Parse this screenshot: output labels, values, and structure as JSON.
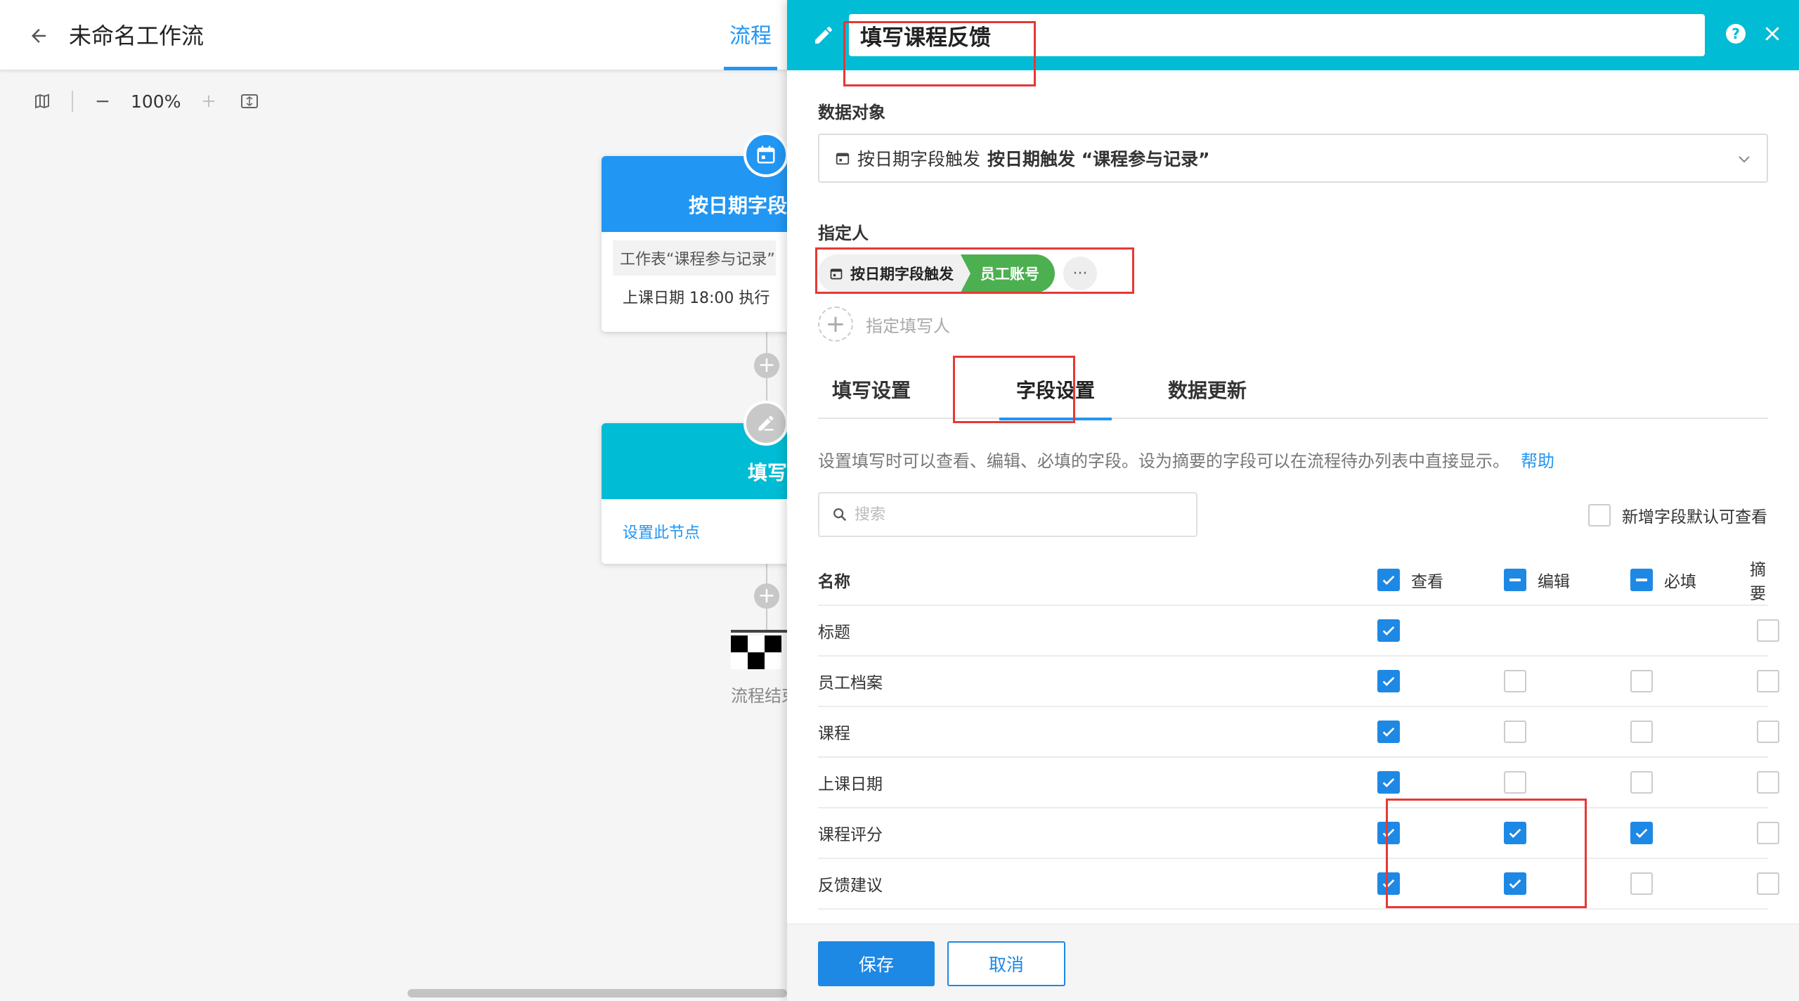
{
  "workflow": {
    "title": "未命名工作流",
    "active_tab": "流程",
    "zoom": "100%",
    "trigger_node": {
      "title": "按日期字段",
      "worksheet": "工作表“课程参与记录”",
      "schedule": "上课日期 18:00 执行",
      "color": "#2196f3"
    },
    "fill_node": {
      "title": "填写",
      "link": "设置此节点",
      "color": "#00bcd4"
    },
    "end_label": "流程结束"
  },
  "panel": {
    "node_name": "填写课程反馈",
    "header_color": "#00bcd4",
    "help_icon": "?",
    "data_object": {
      "label": "数据对象",
      "prefix": "按日期字段触发",
      "value": "按日期触发 “课程参与记录”"
    },
    "assignee": {
      "label": "指定人",
      "source": "按日期字段触发",
      "field": "员工账号",
      "more": "···",
      "add_label": "指定填写人"
    },
    "tabs": [
      {
        "label": "填写设置"
      },
      {
        "label": "字段设置"
      },
      {
        "label": "数据更新"
      }
    ],
    "description": "设置填写时可以查看、编辑、必填的字段。设为摘要的字段可以在流程待办列表中直接显示。",
    "help_link": "帮助",
    "search_placeholder": "搜索",
    "default_view_label": "新增字段默认可查看",
    "table": {
      "headers": {
        "name": "名称",
        "view": "查看",
        "edit": "编辑",
        "required": "必填",
        "summary": "摘要"
      },
      "rows": [
        {
          "name": "标题",
          "view": true,
          "edit": null,
          "required": null,
          "summary": false
        },
        {
          "name": "员工档案",
          "view": true,
          "edit": false,
          "required": false,
          "summary": false
        },
        {
          "name": "课程",
          "view": true,
          "edit": false,
          "required": false,
          "summary": false
        },
        {
          "name": "上课日期",
          "view": true,
          "edit": false,
          "required": false,
          "summary": false
        },
        {
          "name": "课程评分",
          "view": true,
          "edit": true,
          "required": true,
          "summary": false
        },
        {
          "name": "反馈建议",
          "view": true,
          "edit": true,
          "required": false,
          "summary": false
        }
      ]
    },
    "save_label": "保存",
    "cancel_label": "取消",
    "accent_color": "#1e88e5",
    "assignee_chip_color": "#4caf50",
    "highlight_color": "#e53935"
  }
}
